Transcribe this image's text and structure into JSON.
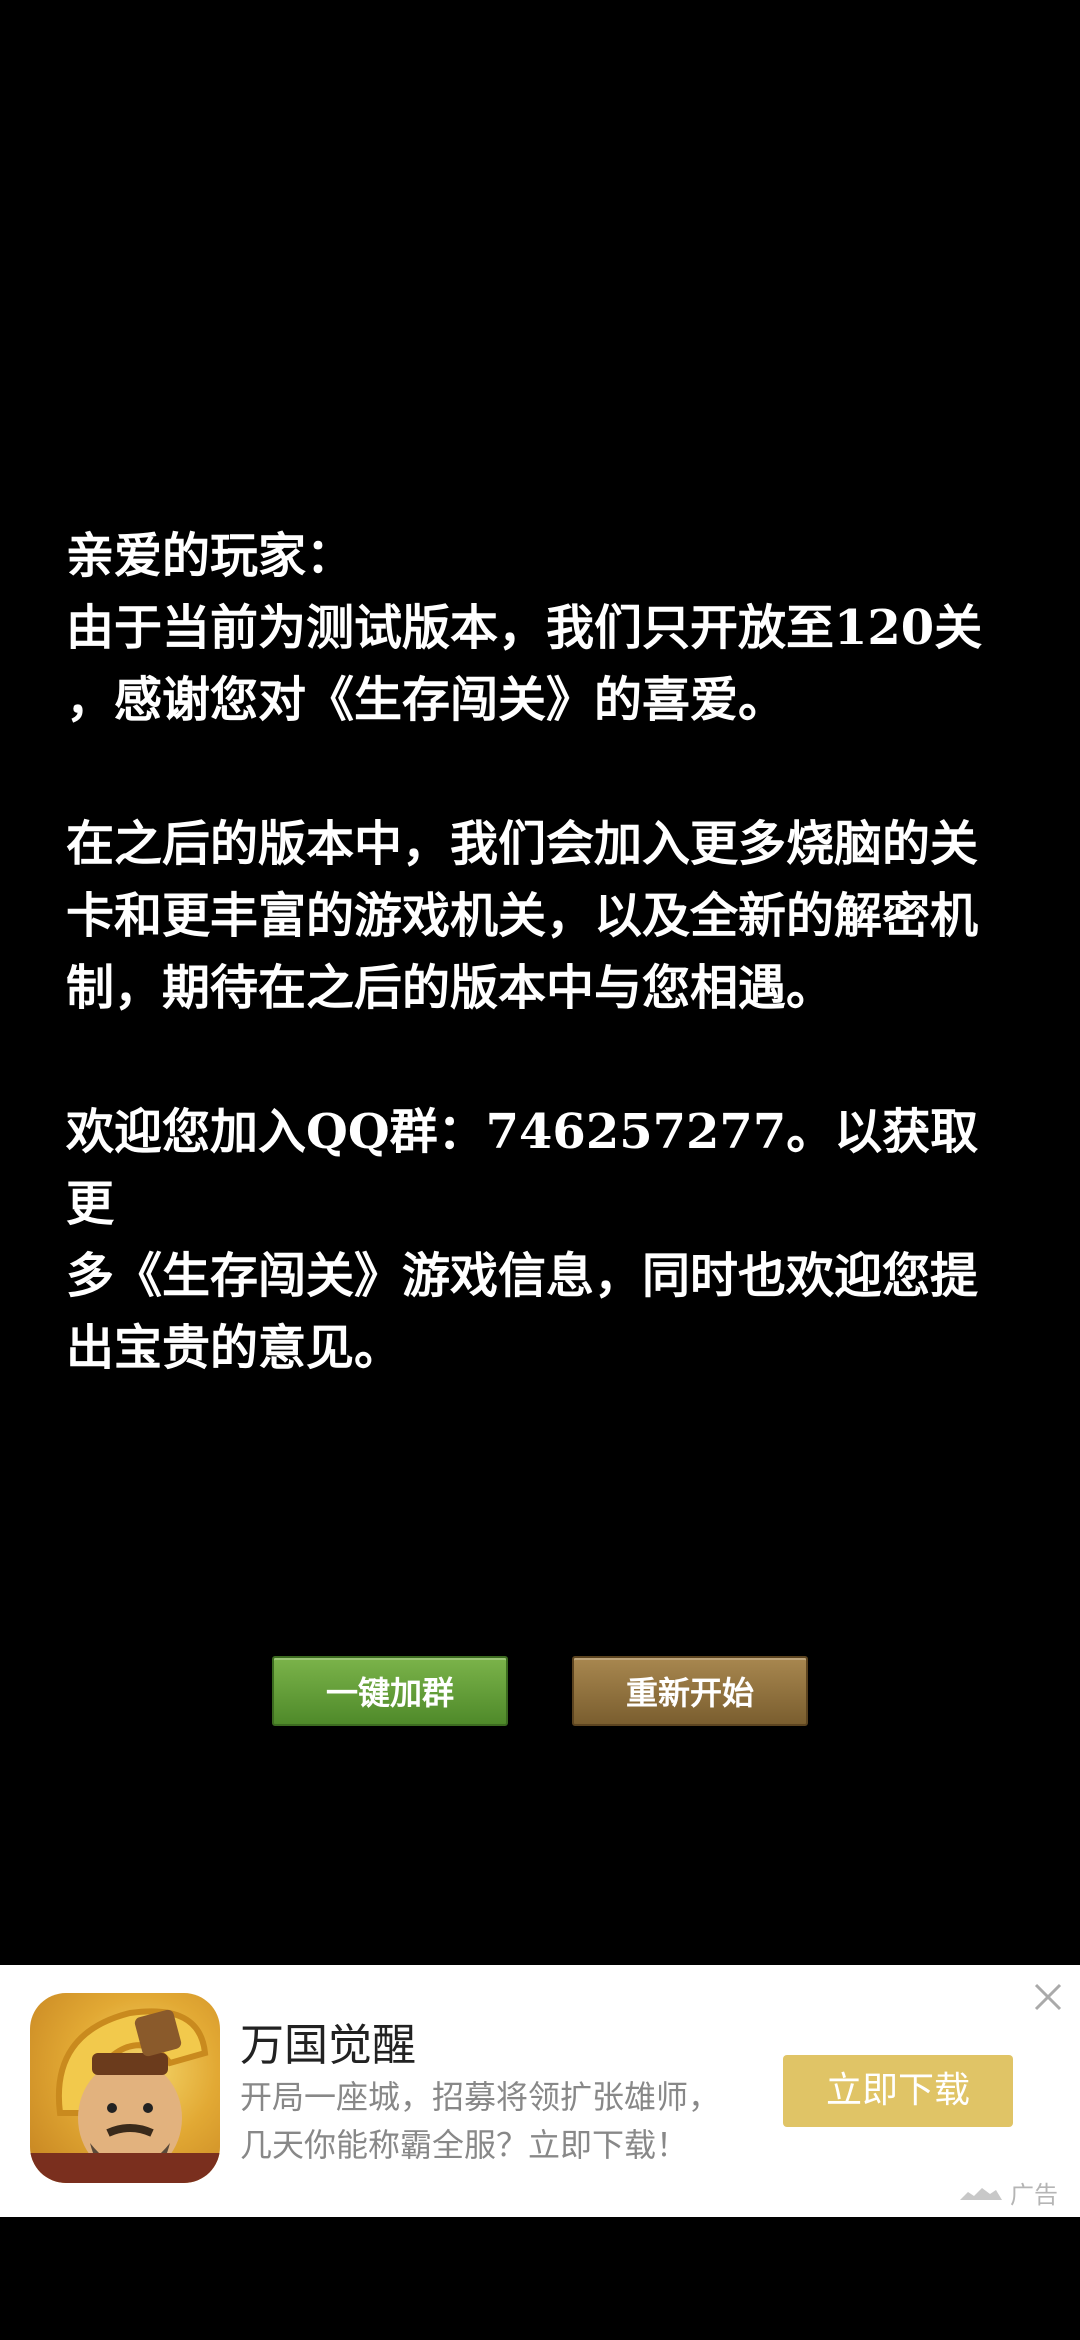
{
  "notice": {
    "greeting": "亲爱的玩家：",
    "line1": "由于当前为测试版本，我们只开放至120关",
    "line2": "，感谢您对《生存闯关》的喜爱。",
    "para2_line1": "在之后的版本中，我们会加入更多烧脑的关",
    "para2_line2": "卡和更丰富的游戏机关，以及全新的解密机",
    "para2_line3": "制，期待在之后的版本中与您相遇。",
    "para3_line1": "欢迎您加入QQ群：746257277。以获取更",
    "para3_line2": "多《生存闯关》游戏信息，同时也欢迎您提",
    "para3_line3": "出宝贵的意见。"
  },
  "buttons": {
    "join_group": "一键加群",
    "restart": "重新开始",
    "join_color": "#5f9a36",
    "restart_color": "#8f703d"
  },
  "ad": {
    "title": "万国觉醒",
    "desc_line1": "开局一座城，招募将领扩张雄师，",
    "desc_line2": "几天你能称霸全服？立即下载！",
    "cta": "立即下载",
    "tag": "广告",
    "icon": "app-icon-warrior",
    "cta_color": "#e0c466"
  }
}
